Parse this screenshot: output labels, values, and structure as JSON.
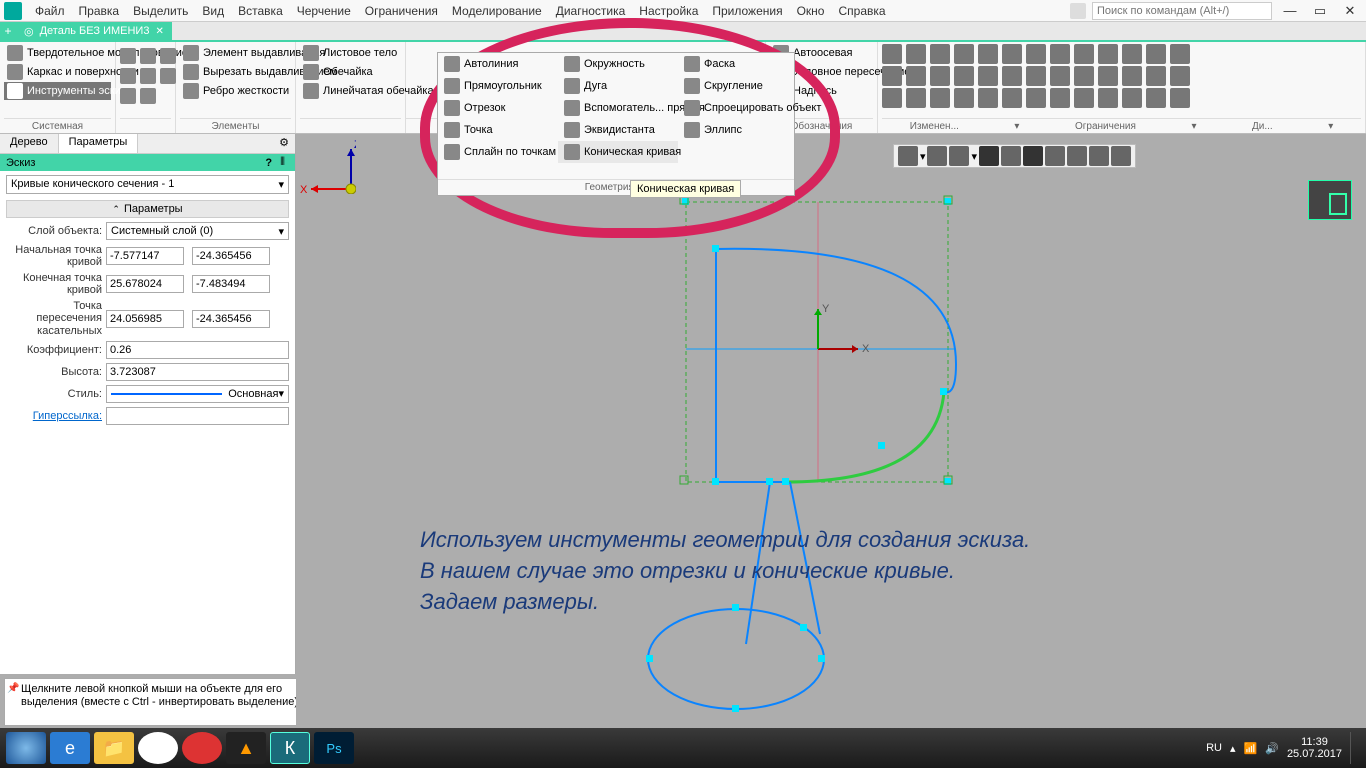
{
  "menubar": {
    "items": [
      "Файл",
      "Правка",
      "Выделить",
      "Вид",
      "Вставка",
      "Черчение",
      "Ограничения",
      "Моделирование",
      "Диагностика",
      "Настройка",
      "Приложения",
      "Окно",
      "Справка"
    ],
    "search_placeholder": "Поиск по командам (Alt+/)"
  },
  "doc_tab": {
    "title": "Деталь БЕЗ ИМЕНИ3"
  },
  "ribbon": {
    "group1": {
      "items": [
        "Твердотельное моделирование",
        "Каркас и поверхности",
        "Инструменты эскиза"
      ],
      "label": "Системная"
    },
    "group2": {
      "items": [
        "Элемент выдавливания",
        "Вырезать выдавливанием",
        "Ребро жесткости"
      ],
      "label": "Элементы"
    },
    "group3": {
      "items": [
        "Листовое тело",
        "Обечайка",
        "Линейчатая обечайка"
      ]
    },
    "geom": {
      "col1": [
        "Автолиния",
        "Прямоугольник",
        "Отрезок",
        "Точка",
        "Сплайн по точкам"
      ],
      "col2": [
        "Окружность",
        "Дуга",
        "Вспомогатель... прямая",
        "Эквидистанта",
        "Коническая кривая"
      ],
      "col3": [
        "Фаска",
        "Скругление",
        "Спроецировать объект",
        "Эллипс"
      ],
      "label": "Геометрия",
      "tooltip": "Коническая кривая"
    },
    "group5": {
      "items": [
        "Автоосевая",
        "Условное пересечение",
        "Надпись"
      ],
      "label": "Обозначения"
    },
    "labels_right": [
      "Изменен...",
      "Ограничения",
      "Ди..."
    ]
  },
  "panel": {
    "tabs": [
      "Дерево",
      "Параметры"
    ],
    "header": "Эскиз",
    "dropdown": "Кривые конического сечения - 1",
    "section": "Параметры",
    "rows": {
      "layer_label": "Слой объекта:",
      "layer_value": "Системный слой (0)",
      "start_label": "Начальная точка кривой",
      "start_x": "-7.577147",
      "start_y": "-24.365456",
      "end_label": "Конечная точка кривой",
      "end_x": "25.678024",
      "end_y": "-7.483494",
      "tangent_label": "Точка пересечения касательных",
      "tangent_x": "24.056985",
      "tangent_y": "-24.365456",
      "coef_label": "Коэффициент:",
      "coef_value": "0.26",
      "height_label": "Высота:",
      "height_value": "3.723087",
      "style_label": "Стиль:",
      "style_value": "Основная",
      "link_label": "Гиперссылка:"
    }
  },
  "hint": "Щелкните левой кнопкой мыши на объекте для его выделения (вместе с Ctrl - инвертировать выделение)",
  "overlay": {
    "line1": "Используем инстументы геометрии для создания эскиза.",
    "line2": "В нашем случае это отрезки и конические кривые.",
    "line3": "Задаем размеры."
  },
  "taskbar": {
    "lang": "RU",
    "time": "11:39",
    "date": "25.07.2017"
  },
  "axis": {
    "x": "X",
    "y": "Y",
    "z": "Z"
  }
}
